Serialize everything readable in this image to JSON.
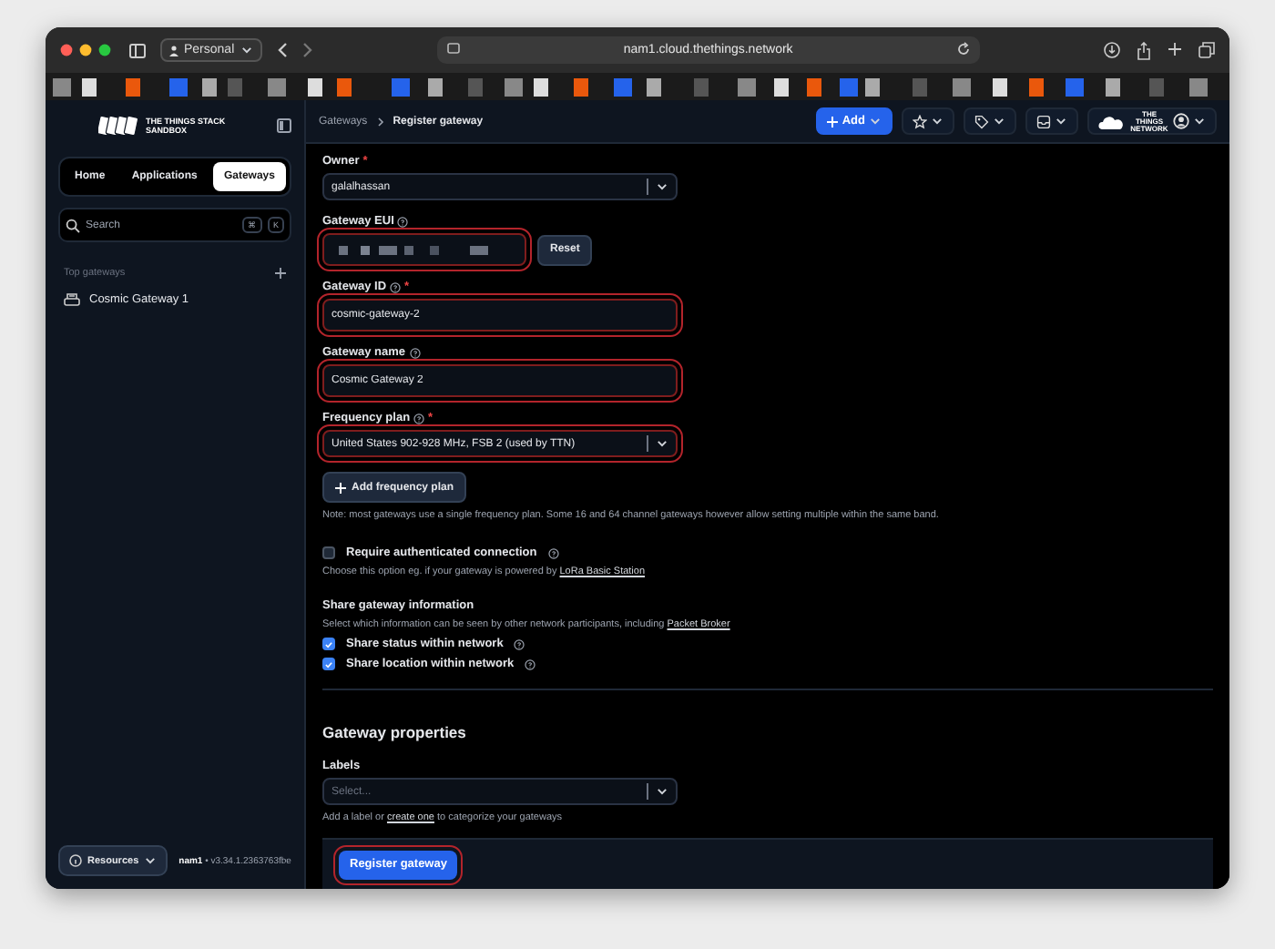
{
  "browser": {
    "profile": "Personal",
    "url": "nam1.cloud.thethings.network"
  },
  "sidebar": {
    "logo_line1": "THE THINGS STACK",
    "logo_line2": "SANDBOX",
    "tabs": [
      {
        "label": "Home",
        "selected": false
      },
      {
        "label": "Applications",
        "selected": false
      },
      {
        "label": "Gateways",
        "selected": true
      }
    ],
    "search": {
      "placeholder": "Search",
      "keys": [
        "⌘",
        "K"
      ]
    },
    "section_title": "Top gateways",
    "items": [
      "Cosmic Gateway 1"
    ],
    "resources_button": "Resources",
    "cluster": "nam1",
    "version": "• v3.34.1.2363763fbe"
  },
  "header": {
    "breadcrumbs": [
      "Gateways",
      "Register gateway"
    ],
    "add_button": "Add",
    "network_logo": "THE THINGS NETWORK"
  },
  "fields": [
    {
      "kind": "select",
      "label": "Owner",
      "required_mark": "*",
      "help": false,
      "value": "galalhassan",
      "highlighted": false
    },
    {
      "kind": "masked",
      "label": "Gateway EUI",
      "help": true,
      "button": "Reset",
      "highlighted": true
    },
    {
      "kind": "text",
      "label": "Gateway ID",
      "required_mark": "*",
      "help": true,
      "value": "cosmic-gateway-2",
      "highlighted": true
    },
    {
      "kind": "text",
      "label": "Gateway name",
      "help": true,
      "value": "Cosmic Gateway 2",
      "highlighted": true
    },
    {
      "kind": "select",
      "label": "Frequency plan",
      "required_mark": "*",
      "help": true,
      "value": "United States 902-928 MHz, FSB 2 (used by TTN)",
      "highlighted": true
    }
  ],
  "add_plan_button": "Add frequency plan",
  "plan_note": "Note: most gateways use a single frequency plan. Some 16 and 64 channel gateways however allow setting multiple within the same band.",
  "auth": {
    "label": "Require authenticated connection",
    "checked": false,
    "description": "Choose this option eg. if your gateway is powered by",
    "link": "LoRa Basic Station"
  },
  "share": {
    "title": "Share gateway information",
    "description": "Select which information can be seen by other network participants, including",
    "link": "Packet Broker",
    "options": [
      {
        "label": "Share status within network",
        "checked": true
      },
      {
        "label": "Share location within network",
        "checked": true
      }
    ]
  },
  "properties": {
    "title": "Gateway properties",
    "labels_label": "Labels",
    "placeholder": "Select...",
    "hint_before": "Add a label or",
    "hint_link": "create one",
    "hint_after": "to categorize your gateways"
  },
  "submit": {
    "label": "Register gateway",
    "highlighted": true
  }
}
